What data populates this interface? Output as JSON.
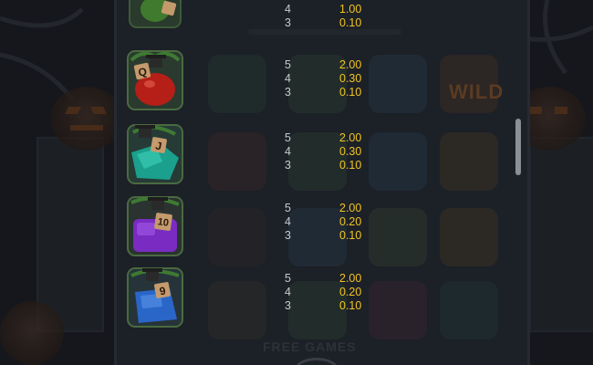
{
  "colors": {
    "background": "#15171c",
    "count_text": "#c7c9cf",
    "value_text": "#f2c41e",
    "scrollbar": "#8c8e98"
  },
  "background": {
    "wild_label": "WILD",
    "free_games_label": "FREE GAMES"
  },
  "paytable": {
    "rows": [
      {
        "symbol_icon": "green-potion-k-icon",
        "lines": [
          {
            "count": "4",
            "value": "1.00"
          },
          {
            "count": "3",
            "value": "0.10"
          }
        ]
      },
      {
        "symbol_icon": "red-potion-q-icon",
        "lines": [
          {
            "count": "5",
            "value": "2.00"
          },
          {
            "count": "4",
            "value": "0.30"
          },
          {
            "count": "3",
            "value": "0.10"
          }
        ]
      },
      {
        "symbol_icon": "teal-potion-j-icon",
        "lines": [
          {
            "count": "5",
            "value": "2.00"
          },
          {
            "count": "4",
            "value": "0.30"
          },
          {
            "count": "3",
            "value": "0.10"
          }
        ]
      },
      {
        "symbol_icon": "purple-potion-10-icon",
        "lines": [
          {
            "count": "5",
            "value": "2.00"
          },
          {
            "count": "4",
            "value": "0.20"
          },
          {
            "count": "3",
            "value": "0.10"
          }
        ]
      },
      {
        "symbol_icon": "blue-potion-9-icon",
        "lines": [
          {
            "count": "5",
            "value": "2.00"
          },
          {
            "count": "4",
            "value": "0.20"
          },
          {
            "count": "3",
            "value": "0.10"
          }
        ]
      }
    ],
    "symbol_letters": [
      "K",
      "Q",
      "J",
      "10",
      "9"
    ]
  }
}
